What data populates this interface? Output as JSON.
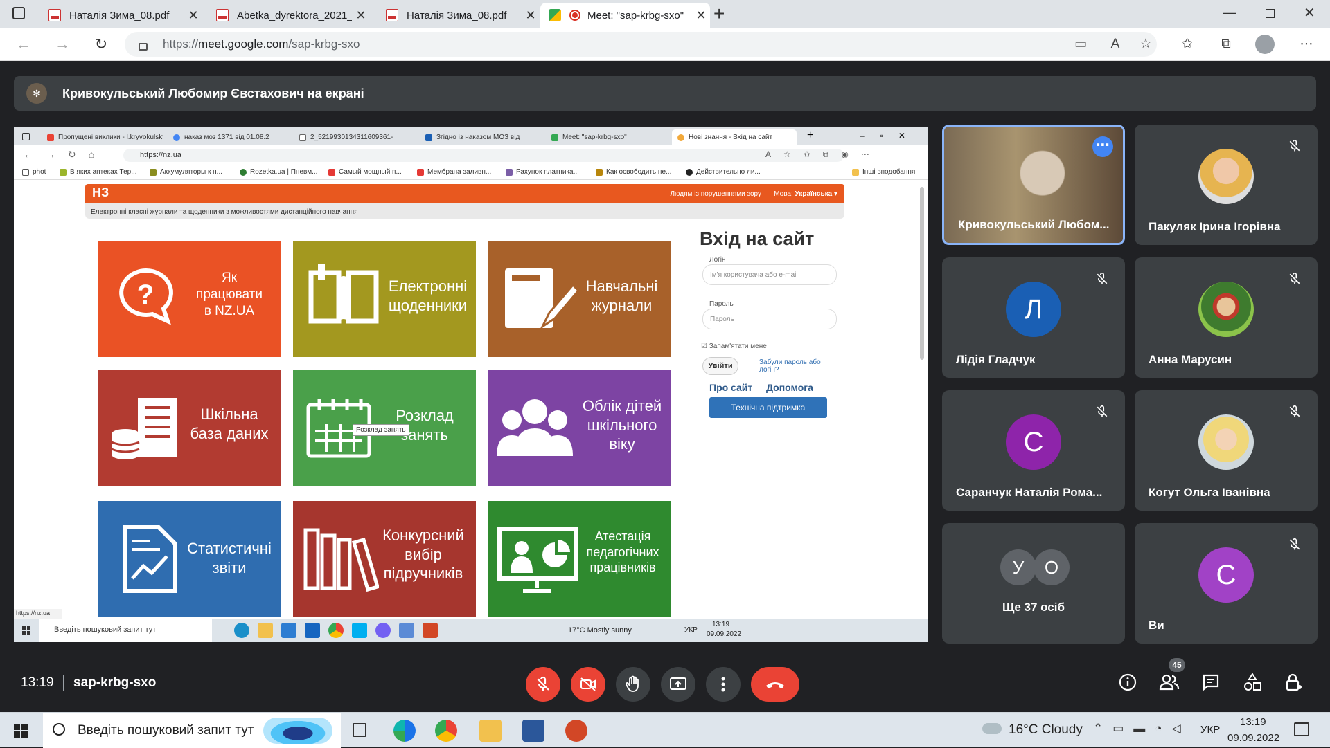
{
  "browser": {
    "tabs": [
      {
        "label": "Наталія Зима_08.pdf",
        "icon": "pdf-icon"
      },
      {
        "label": "Abetka_dyrektora_2021_SQE_SUP_",
        "icon": "pdf-icon"
      },
      {
        "label": "Наталія Зима_08.pdf",
        "icon": "pdf-icon"
      },
      {
        "label": "Meet: \"sap-krbg-sxo\"",
        "icon": "meet-icon",
        "active": true
      }
    ],
    "url_prefix": "https://",
    "url_host": "meet.google.com",
    "url_path": "/sap-krbg-sxo"
  },
  "presentation": {
    "banner": "Кривокульський Любомир Євстахович на екрані"
  },
  "shared_screen": {
    "tabs": [
      "Пропущені виклики - l.kryvokulsky",
      "наказ моз 1371 від 01.08.2",
      "2_5219930134311609361-",
      "Згідно із наказом МОЗ від",
      "Meet: \"sap-krbg-sxo\"",
      "Нові знання - Вхід на сайт"
    ],
    "url": "https://nz.ua",
    "bookmarks": [
      "phot",
      "В яких аптеках Тер...",
      "Аккумуляторы к н...",
      "Rozetka.ua | Пневм...",
      "Самый мощный п...",
      "Мембрана заливн...",
      "Рахунок платника...",
      "Как освободить не...",
      "Действительно ли...",
      "Інші вподобання"
    ],
    "site": {
      "logo": "НЗ",
      "visually_impaired": "Людям із порушеннями зору",
      "language_label": "Мова:",
      "language": "Українська",
      "subtitle": "Електронні класні журнали та щоденники з можливостями дистанційного навчання",
      "tiles": [
        {
          "label": "Як працювати в NZ.UA",
          "color": "#ea5225"
        },
        {
          "label": "Електронні щоденники",
          "color": "#a3981f"
        },
        {
          "label": "Навчальні журнали",
          "color": "#a8612a"
        },
        {
          "label": "Шкільна база даних",
          "color": "#b23b31"
        },
        {
          "label": "Розклад занять",
          "color": "#4aa04a"
        },
        {
          "label": "Облік дітей шкільного віку",
          "color": "#7d44a3"
        },
        {
          "label": "Статистичні звіти",
          "color": "#2f6db0"
        },
        {
          "label": "Конкурсний вибір підручників",
          "color": "#a6362e"
        },
        {
          "label": "Атестація педагогічних працівників",
          "color": "#2f8a2f"
        }
      ],
      "tooltip": "Розклад занять",
      "login": {
        "title": "Вхід на сайт",
        "login_label": "Логін",
        "login_placeholder": "Ім'я користувача або e-mail",
        "password_label": "Пароль",
        "password_placeholder": "Пароль",
        "remember": "Запам'ятати мене",
        "submit": "Увійти",
        "forgot": "Забули пароль або логін?",
        "about": "Про сайт",
        "help": "Допомога",
        "support": "Технічна підтримка"
      }
    },
    "status_url": "https://nz.ua",
    "taskbar": {
      "search": "Введіть пошуковий запит тут",
      "weather": "17°C Mostly sunny",
      "lang": "УКР",
      "time": "13:19",
      "date": "09.09.2022"
    }
  },
  "participants": [
    {
      "name": "Кривокульський Любом...",
      "video": true,
      "more": true
    },
    {
      "name": "Пакуляк Ірина Ігорівна",
      "photo": true,
      "muted": true
    },
    {
      "name": "Лідія Гладчук",
      "initial": "Л",
      "color": "#1a5fb4",
      "muted": true
    },
    {
      "name": "Анна Марусин",
      "photo": true,
      "muted": true
    },
    {
      "name": "Саранчук Наталія Рома...",
      "initial": "С",
      "color": "#8e24aa",
      "muted": true
    },
    {
      "name": "Когут Ольга Іванівна",
      "photo": true,
      "muted": true
    },
    {
      "name": "Ще 37 осіб",
      "initials": [
        "У",
        "О"
      ]
    },
    {
      "name": "Ви",
      "initial": "С",
      "color": "#a142c6",
      "muted": true
    }
  ],
  "meeting_bar": {
    "time": "13:19",
    "code": "sap-krbg-sxo",
    "participants_count": "45"
  },
  "windows_taskbar": {
    "search": "Введіть пошуковий запит тут",
    "weather": "16°C Cloudy",
    "lang": "УКР",
    "time": "13:19",
    "date": "09.09.2022"
  }
}
